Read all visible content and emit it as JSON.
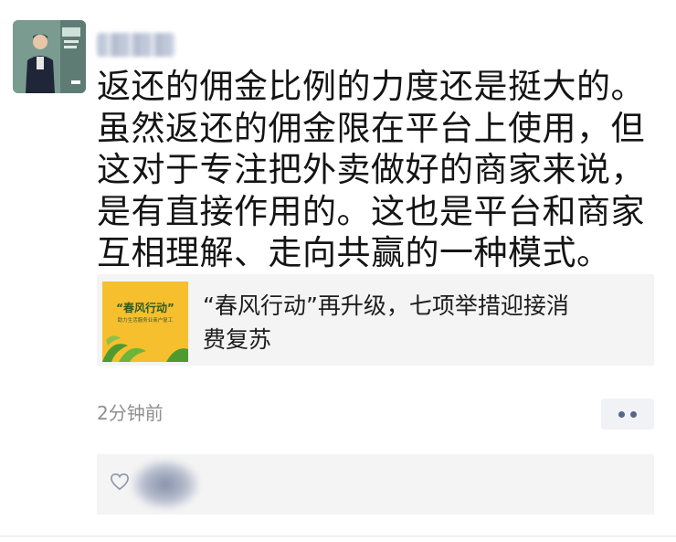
{
  "post": {
    "author_avatar_icon": "avatar-icon",
    "username": "",
    "text_lines": [
      "返还的佣金比例的力度还是挺大的。",
      "虽然返还的佣金限在平台上使用，但",
      "这对于专注把外卖做好的商家来说，",
      "是有直接作用的。这也是平台和商家",
      "互相理解、走向共赢的一种模式。"
    ],
    "link_card": {
      "thumb_title": "“春风行动”",
      "thumb_subtitle": "助力生活服务业商户复工",
      "title_line1": "“春风行动”再升级，七项举措迎接消",
      "title_line2": "费复苏"
    },
    "time": "2分钟前",
    "more_icon": "more-dots-icon",
    "like_icon": "heart-icon"
  },
  "colors": {
    "text": "#141414",
    "time": "#8f8f8f",
    "card_bg": "#f4f4f4",
    "thumb_bg": "#f6bf2e",
    "more_dots": "#56658a"
  }
}
